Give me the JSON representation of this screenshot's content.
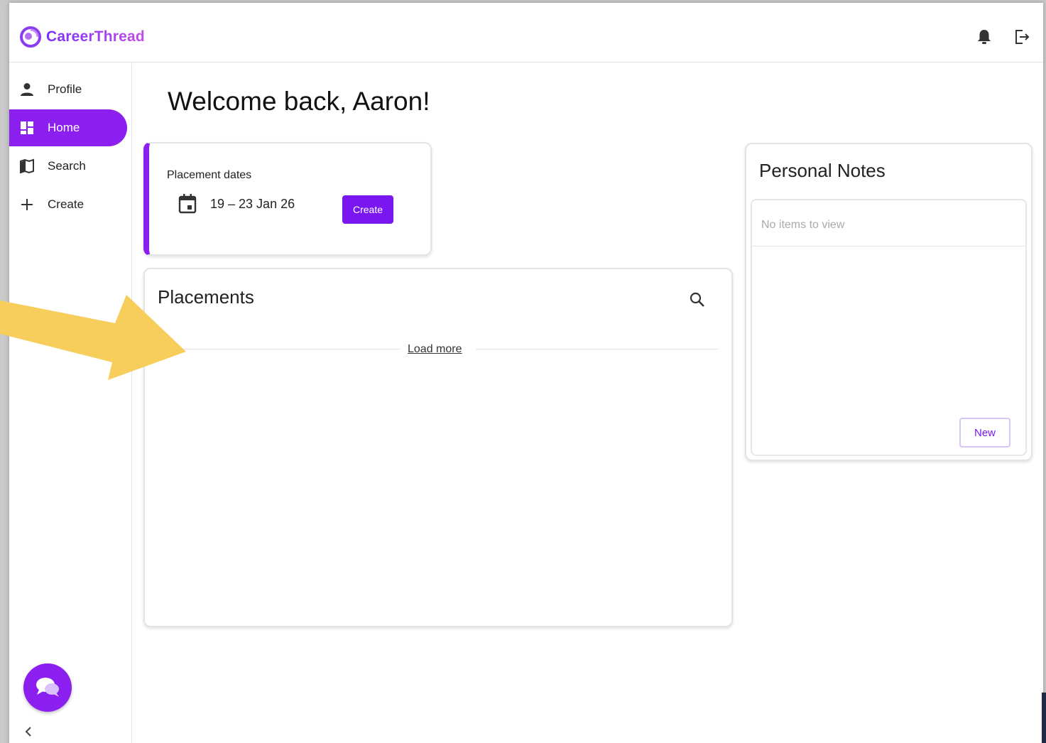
{
  "app": {
    "name": "CareerThread"
  },
  "topbar": {
    "notifications_icon": "bell-icon",
    "logout_icon": "logout-icon"
  },
  "sidebar": {
    "items": [
      {
        "label": "Profile",
        "icon": "person-icon",
        "active": false
      },
      {
        "label": "Home",
        "icon": "dashboard-icon",
        "active": true
      },
      {
        "label": "Search",
        "icon": "map-icon",
        "active": false
      },
      {
        "label": "Create",
        "icon": "plus-icon",
        "active": false
      }
    ],
    "chat_icon": "chat-bubbles-icon",
    "collapse_icon": "chevron-left-icon"
  },
  "main": {
    "welcome": "Welcome back, Aaron!",
    "placement_dates": {
      "title": "Placement dates",
      "range": "19 – 23 Jan 26",
      "create_label": "Create"
    },
    "placements": {
      "title": "Placements",
      "load_more": "Load more"
    },
    "notes": {
      "title": "Personal Notes",
      "empty": "No items to view",
      "new_label": "New"
    }
  },
  "colors": {
    "accent": "#8a1ff0",
    "annotation_arrow": "#f7cd5c"
  }
}
